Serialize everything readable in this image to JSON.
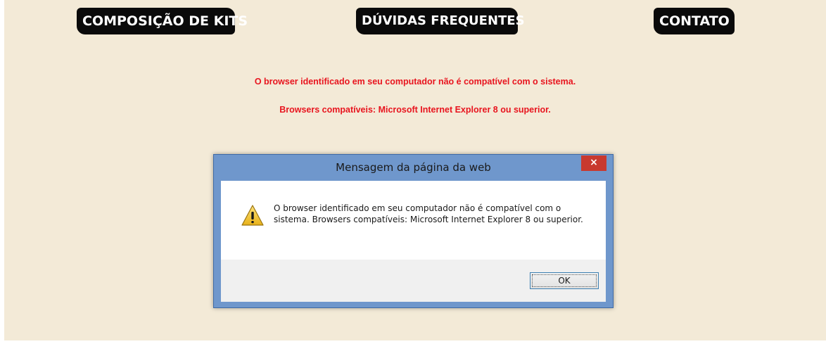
{
  "nav": {
    "kits_label": "COMPOSIÇÃO DE KITS",
    "faq_label": "DÚVIDAS FREQUENTES",
    "contact_label": "CONTATO"
  },
  "warning": {
    "line1": "O browser identificado em seu computador não é compatível com o sistema.",
    "line2": "Browsers compatíveis: Microsoft Internet Explorer 8 ou superior.",
    "color": "#e8141e"
  },
  "dialog": {
    "title": "Mensagem da página da web",
    "close_symbol": "×",
    "icon": "warning-icon",
    "message": "O browser identificado em seu computador não é compatível com o sistema. Browsers compatíveis: Microsoft Internet Explorer 8 ou superior.",
    "ok_label": "OK"
  },
  "colors": {
    "page_background": "#f3ead7",
    "nav_button": "#0a0a0a",
    "dialog_frame": "#6f97cc",
    "close_button": "#c8392f"
  }
}
